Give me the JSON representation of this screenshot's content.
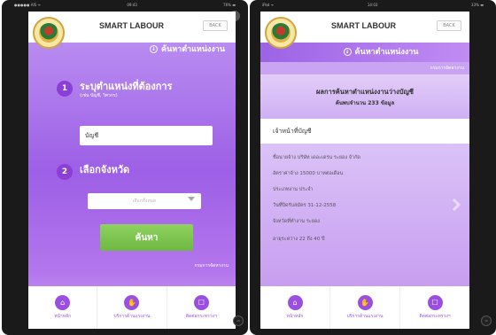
{
  "screen1": {
    "status": {
      "carrier": "●●●●● AIS ᯤ",
      "time": "09:43",
      "battery": "76% ▬"
    },
    "app_title": "SMART LABOUR",
    "back_label": "BACK",
    "subhead": "ค้นหาตำแหน่งงาน",
    "subhead_icon": "↓",
    "step1": {
      "number": "1",
      "title": "ระบุตำแหน่งที่ต้องการ",
      "hint": "(เช่น บัญชี, วิศวกร)",
      "input_value": "บัญชี"
    },
    "step2": {
      "number": "2",
      "title": "เลือกจังหวัด",
      "select_placeholder": "เลือกทั้งหมด"
    },
    "search_label": "ค้นหา",
    "footer_link": "กรมการจัดหางาน",
    "nav": [
      {
        "label": "หน้าหลัก",
        "icon": "home-icon",
        "glyph": "⌂"
      },
      {
        "label": "บริการด้านแรงงาน",
        "icon": "thumbs-up-icon",
        "glyph": "✋"
      },
      {
        "label": "ติดต่อกระทรวงฯ",
        "icon": "phone-icon",
        "glyph": "☐"
      }
    ]
  },
  "screen2": {
    "status": {
      "carrier": "iPad ᯤ",
      "time": "14:03",
      "battery": "33% ▬"
    },
    "app_title": "SMART LABOUR",
    "back_label": "BACK",
    "subhead": "ค้นหาตำแหน่งงาน",
    "subhead_icon": "↓",
    "dept_label": "กรมการจัดหางาน",
    "result_title": "ผลการค้นหาตำแหน่งงานว่างบัญชี",
    "result_count": "ค้นพบจำนวน 233 ข้อมูล",
    "job_title": "เจ้าหน้าที่บัญชี",
    "job_lines": [
      "ชื่อนายจ้าง บริษัท เดอะเดรน ระยอง จำกัด",
      "อัตราค่าจ้าง 15000 บาทต่อเดือน",
      "ประเภทงาน ประจำ",
      "วันที่ปิดรับสมัคร 31-12-2558",
      "จังหวัดที่ทำงาน ระยอง",
      "อายุระหว่าง 22 ถึง 40 ปี"
    ],
    "nav": [
      {
        "label": "หน้าหลัก",
        "icon": "home-icon",
        "glyph": "⌂"
      },
      {
        "label": "บริการด้านแรงงาน",
        "icon": "thumbs-up-icon",
        "glyph": "✋"
      },
      {
        "label": "ติดต่อกระทรวงฯ",
        "icon": "phone-icon",
        "glyph": "☐"
      }
    ]
  },
  "colors": {
    "accent": "#9b4fe0",
    "search_green": "#7cc44f",
    "purple_bg": "#a366e8"
  }
}
